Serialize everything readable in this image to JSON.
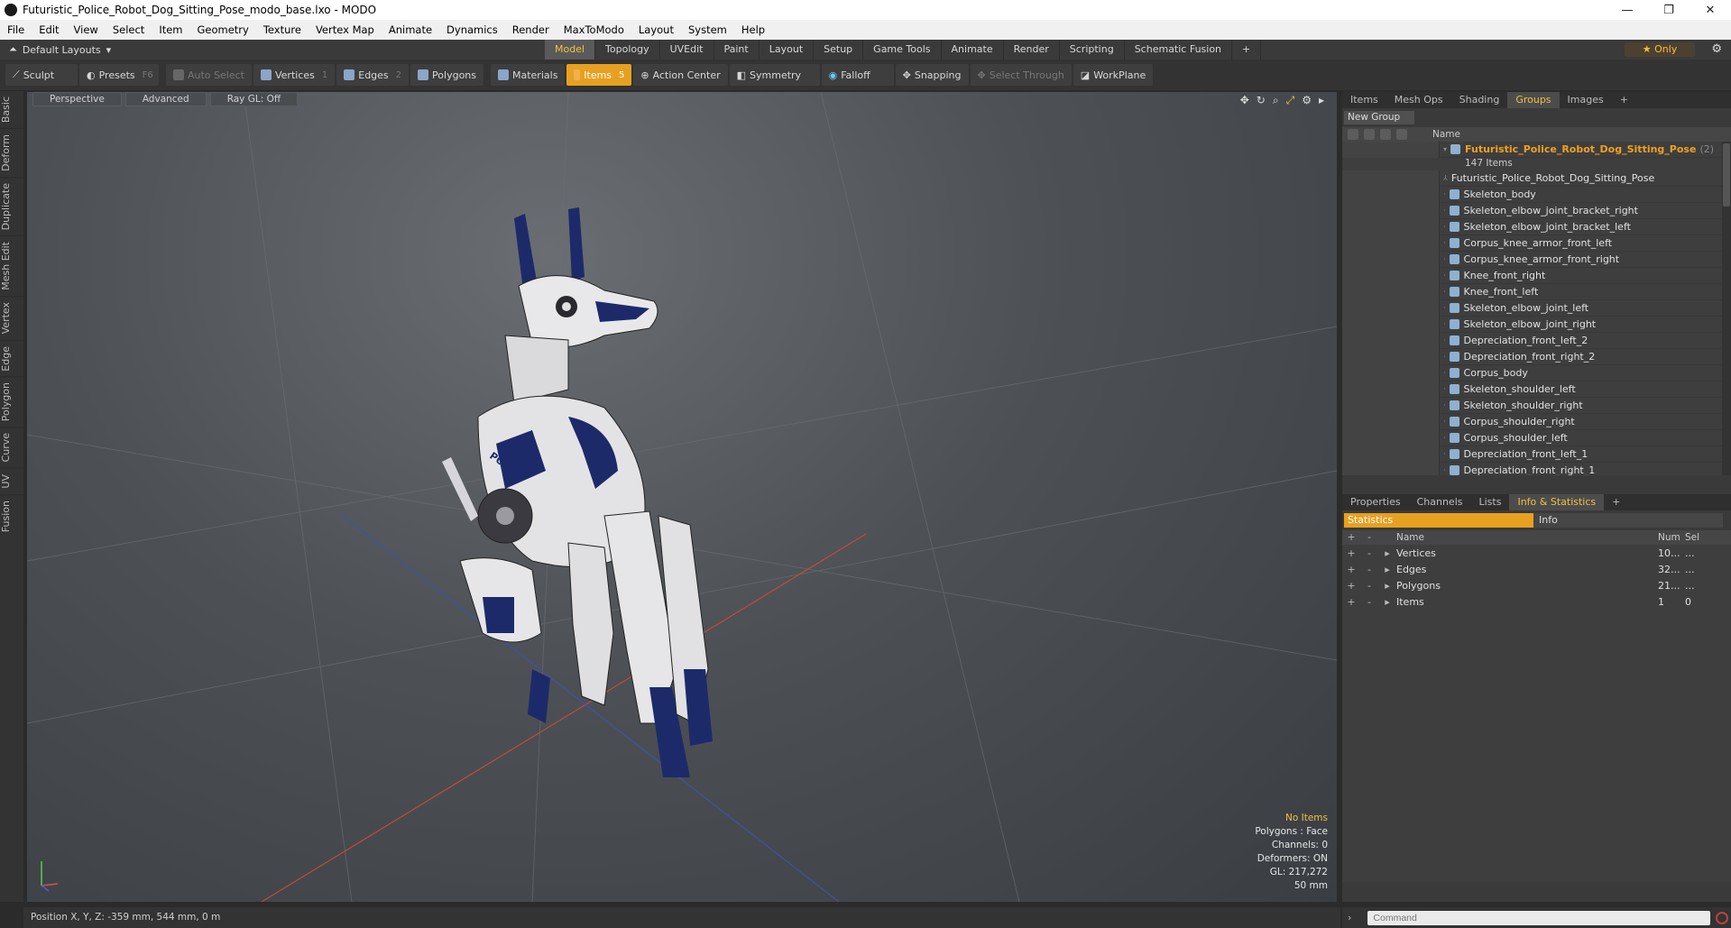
{
  "window": {
    "title": "Futuristic_Police_Robot_Dog_Sitting_Pose_modo_base.lxo - MODO",
    "minimize": "—",
    "maximize": "❐",
    "close": "✕"
  },
  "menu": [
    "File",
    "Edit",
    "View",
    "Select",
    "Item",
    "Geometry",
    "Texture",
    "Vertex Map",
    "Animate",
    "Dynamics",
    "Render",
    "MaxToModo",
    "Layout",
    "System",
    "Help"
  ],
  "layoutbar": {
    "layout": "Default Layouts",
    "tabs": [
      "Model",
      "Topology",
      "UVEdit",
      "Paint",
      "Layout",
      "Setup",
      "Game Tools",
      "Animate",
      "Render",
      "Scripting",
      "Schematic Fusion"
    ],
    "active_tab": "Model",
    "only": "Only"
  },
  "toolbar": {
    "sculpt": "Sculpt",
    "presets": "Presets",
    "presets_key": "F6",
    "auto_select": "Auto Select",
    "vertices": "Vertices",
    "vertices_count": "1",
    "edges": "Edges",
    "edges_count": "2",
    "polygons": "Polygons",
    "materials": "Materials",
    "items": "Items",
    "items_count": "5",
    "action_center": "Action Center",
    "symmetry": "Symmetry",
    "falloff": "Falloff",
    "snapping": "Snapping",
    "select_through": "Select Through",
    "workplane": "WorkPlane"
  },
  "lefttabs": [
    "Basic",
    "Deform",
    "Duplicate",
    "Mesh Edit",
    "Vertex",
    "Edge",
    "Polygon",
    "Curve",
    "UV",
    "Fusion"
  ],
  "viewport": {
    "view": "Perspective",
    "shading": "Advanced",
    "raygl": "Ray GL: Off",
    "info": {
      "no_items": "No Items",
      "polygons": "Polygons : Face",
      "channels": "Channels: 0",
      "deformers": "Deformers: ON",
      "gl": "GL: 217,272",
      "focal": "50 mm"
    },
    "model_label": "POLICE"
  },
  "groups_panel": {
    "tabs": [
      "Items",
      "Mesh Ops",
      "Shading",
      "Groups",
      "Images"
    ],
    "active_tab": "Groups",
    "new_group": "New Group",
    "name_header": "Name",
    "group_name": "Futuristic_Police_Robot_Dog_Sitting_Pose",
    "group_count": "(2)",
    "item_count": "147 Items",
    "items": [
      "Futuristic_Police_Robot_Dog_Sitting_Pose",
      "Skeleton_body",
      "Skeleton_elbow_joint_bracket_right",
      "Skeleton_elbow_joint_bracket_left",
      "Corpus_knee_armor_front_left",
      "Corpus_knee_armor_front_right",
      "Knee_front_right",
      "Knee_front_left",
      "Skeleton_elbow_joint_left",
      "Skeleton_elbow_joint_right",
      "Depreciation_front_left_2",
      "Depreciation_front_right_2",
      "Corpus_body",
      "Skeleton_shoulder_left",
      "Skeleton_shoulder_right",
      "Corpus_shoulder_right",
      "Corpus_shoulder_left",
      "Depreciation_front_left_1",
      "Depreciation_front_right_1"
    ]
  },
  "stats_panel": {
    "tabs": [
      "Properties",
      "Channels",
      "Lists",
      "Info & Statistics"
    ],
    "active_tab": "Info & Statistics",
    "statistics": "Statistics",
    "info": "Info",
    "head_name": "Name",
    "head_num": "Num",
    "head_sel": "Sel",
    "rows": [
      {
        "name": "Vertices",
        "num": "10...",
        "sel": "..."
      },
      {
        "name": "Edges",
        "num": "32...",
        "sel": "..."
      },
      {
        "name": "Polygons",
        "num": "21...",
        "sel": "..."
      },
      {
        "name": "Items",
        "num": "1",
        "sel": "0"
      }
    ]
  },
  "statusbar": {
    "position": "Position X, Y, Z:   -359 mm, 544 mm, 0 m"
  },
  "command": {
    "placeholder": "Command"
  }
}
